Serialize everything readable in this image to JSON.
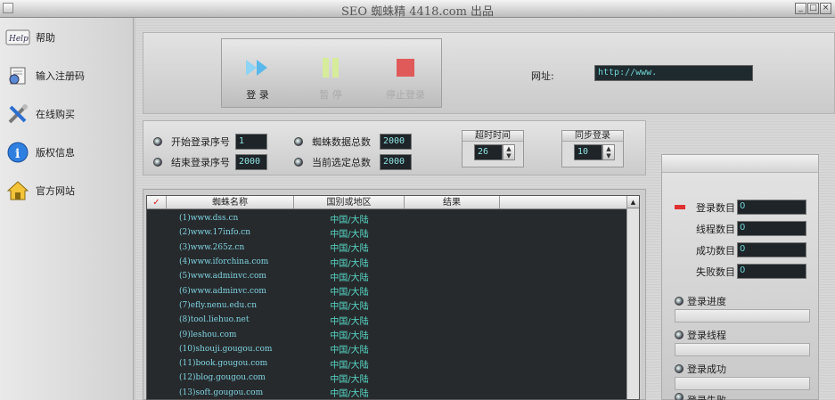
{
  "window": {
    "title": "SEO 蜘蛛精 4418.com 出品",
    "btns": [
      "_",
      "□",
      "×"
    ]
  },
  "sidebar": {
    "items": [
      {
        "label": "帮助",
        "icon": "help-icon"
      },
      {
        "label": "输入注册码",
        "icon": "register-icon"
      },
      {
        "label": "在线购买",
        "icon": "tools-icon"
      },
      {
        "label": "版权信息",
        "icon": "info-icon"
      },
      {
        "label": "官方网站",
        "icon": "home-icon"
      }
    ]
  },
  "controls": {
    "login": "登 录",
    "pause": "暂 停",
    "stop": "停止登录"
  },
  "url": {
    "label": "网址:",
    "value": "http://www."
  },
  "config": {
    "start_label": "开始登录序号",
    "start_value": "1",
    "end_label": "结束登录序号",
    "end_value": "2000",
    "total_label": "蜘蛛数据总数",
    "total_value": "2000",
    "selected_label": "当前选定总数",
    "selected_value": "2000",
    "timeout_title": "超时时间",
    "timeout_value": "26",
    "sync_title": "同步登录",
    "sync_value": "10"
  },
  "list": {
    "columns": [
      "蜘蛛名称",
      "国别或地区",
      "结果"
    ],
    "rows": [
      {
        "name": "(1)www.dss.cn",
        "region": "中国/大陆",
        "result": ""
      },
      {
        "name": "(2)www.17info.cn",
        "region": "中国/大陆",
        "result": ""
      },
      {
        "name": "(3)www.265z.cn",
        "region": "中国/大陆",
        "result": ""
      },
      {
        "name": "(4)www.iforchina.com",
        "region": "中国/大陆",
        "result": ""
      },
      {
        "name": "(5)www.adminvc.com",
        "region": "中国/大陆",
        "result": ""
      },
      {
        "name": "(6)www.adminvc.com",
        "region": "中国/大陆",
        "result": ""
      },
      {
        "name": "(7)efly.nenu.edu.cn",
        "region": "中国/大陆",
        "result": ""
      },
      {
        "name": "(8)tool.liehuo.net",
        "region": "中国/大陆",
        "result": ""
      },
      {
        "name": "(9)leshou.com",
        "region": "中国/大陆",
        "result": ""
      },
      {
        "name": "(10)shouji.gougou.com",
        "region": "中国/大陆",
        "result": ""
      },
      {
        "name": "(11)book.gougou.com",
        "region": "中国/大陆",
        "result": ""
      },
      {
        "name": "(12)blog.gougou.com",
        "region": "中国/大陆",
        "result": ""
      },
      {
        "name": "(13)soft.gougou.com",
        "region": "中国/大陆",
        "result": ""
      }
    ]
  },
  "stats": {
    "login_count_label": "登录数目",
    "login_count": "0",
    "thread_count_label": "线程数目",
    "thread_count": "0",
    "success_count_label": "成功数目",
    "success_count": "0",
    "fail_count_label": "失败数目",
    "fail_count": "0",
    "progress_label": "登录进度",
    "thread_label": "登录线程",
    "success_label": "登录成功",
    "fail_label": "登录失败"
  }
}
